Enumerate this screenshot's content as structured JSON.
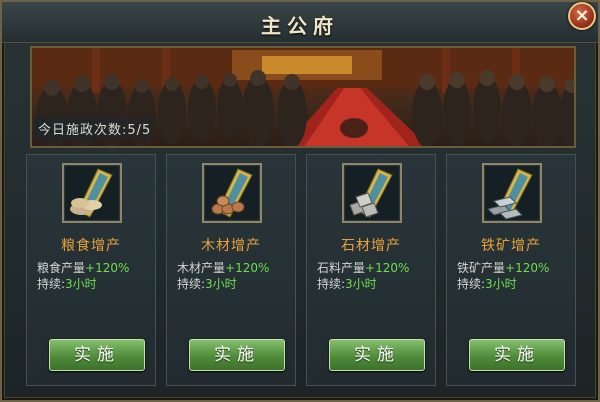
{
  "window": {
    "title": "主公府",
    "close_label": "×"
  },
  "banner": {
    "sessions_text": "今日施政次数:5/5"
  },
  "cards": [
    {
      "title": "粮食增产",
      "stat_label": "粮食产量",
      "stat_value": "+120%",
      "duration_label": "持续:",
      "duration_value": "3小时",
      "button_label": "实施",
      "icon": "grain-sacks-icon"
    },
    {
      "title": "木材增产",
      "stat_label": "木材产量",
      "stat_value": "+120%",
      "duration_label": "持续:",
      "duration_value": "3小时",
      "button_label": "实施",
      "icon": "lumber-logs-icon"
    },
    {
      "title": "石材增产",
      "stat_label": "石料产量",
      "stat_value": "+120%",
      "duration_label": "持续:",
      "duration_value": "3小时",
      "button_label": "实施",
      "icon": "stone-blocks-icon"
    },
    {
      "title": "铁矿增产",
      "stat_label": "铁矿产量",
      "stat_value": "+120%",
      "duration_label": "持续:",
      "duration_value": "3小时",
      "button_label": "实施",
      "icon": "iron-ingots-icon"
    }
  ],
  "colors": {
    "accent_orange": "#e9a23a",
    "stat_green": "#6fdd4d",
    "button_green": "#4f8b3a",
    "close_red": "#b6401f"
  }
}
